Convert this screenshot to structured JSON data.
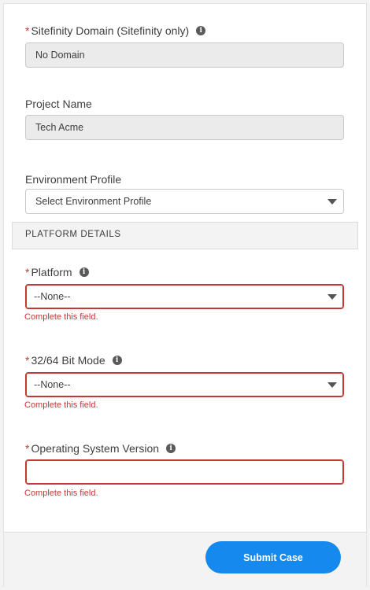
{
  "fields": {
    "sitefinity_domain": {
      "required_marker": "*",
      "label": "Sitefinity Domain (Sitefinity only)",
      "value": "No Domain",
      "info_icon": "info-icon"
    },
    "project_name": {
      "label": "Project Name",
      "value": "Tech Acme"
    },
    "environment_profile": {
      "label": "Environment Profile",
      "value": "Select Environment Profile"
    },
    "platform": {
      "required_marker": "*",
      "label": "Platform",
      "value": "--None--",
      "error": "Complete this field.",
      "info_icon": "info-icon"
    },
    "bit_mode": {
      "required_marker": "*",
      "label": "32/64 Bit Mode",
      "value": "--None--",
      "error": "Complete this field.",
      "info_icon": "info-icon"
    },
    "os_version": {
      "required_marker": "*",
      "label": "Operating System Version",
      "value": "",
      "error": "Complete this field.",
      "info_icon": "info-icon"
    }
  },
  "sections": {
    "platform_details": "PLATFORM DETAILS"
  },
  "footer": {
    "submit_label": "Submit Case"
  },
  "colors": {
    "error": "#c23934",
    "brand_button": "#1589ee",
    "readonly_bg": "#ebebeb"
  }
}
